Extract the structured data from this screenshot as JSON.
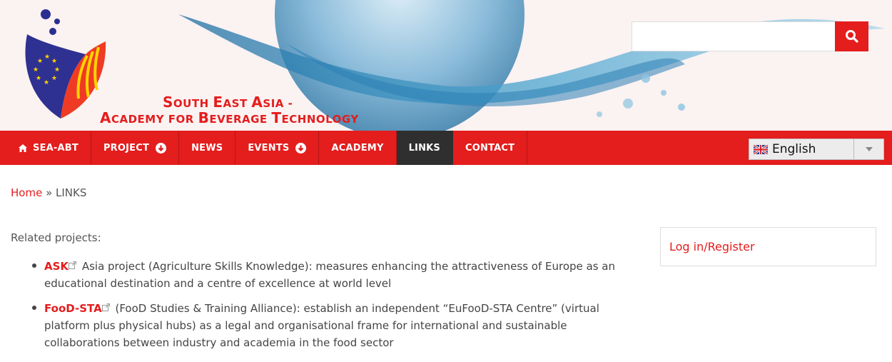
{
  "header": {
    "title_line1_parts": [
      "S",
      "OUTH ",
      "E",
      "AST ",
      "A",
      "SIA -"
    ],
    "title_line2_parts": [
      "A",
      "CADEMY FOR ",
      "B",
      "EVERAGE ",
      "T",
      "ECHNOLOGY"
    ]
  },
  "search": {
    "placeholder": "",
    "value": "",
    "icon": "search-icon"
  },
  "nav": {
    "items": [
      {
        "label": "SEA-ABT",
        "icon": "home-icon",
        "dropdown": false,
        "active": false
      },
      {
        "label": "PROJECT",
        "dropdown": true,
        "active": false
      },
      {
        "label": "NEWS",
        "dropdown": false,
        "active": false
      },
      {
        "label": "EVENTS",
        "dropdown": true,
        "active": false
      },
      {
        "label": "ACADEMY",
        "dropdown": false,
        "active": false
      },
      {
        "label": "LINKS",
        "dropdown": false,
        "active": true
      },
      {
        "label": "CONTACT",
        "dropdown": false,
        "active": false
      }
    ],
    "language": {
      "selected": "English",
      "flag_icon": "uk-flag-icon"
    }
  },
  "breadcrumb": {
    "home": "Home",
    "separator": " » ",
    "current": "LINKS"
  },
  "content": {
    "intro": "Related projects:",
    "projects": [
      {
        "link": "ASK",
        "text": "Asia project (Agriculture Skills Knowledge): measures enhancing the attractiveness of Europe as an educational destination and a centre of excellence at world level"
      },
      {
        "link": "FooD-STA",
        "text": "(FooD Studies & Training Alliance): establish an independent “EuFooD-STA Centre” (virtual platform plus physical hubs) as a legal and organisational frame for international and sustainable collaborations between industry and academia in the food sector"
      }
    ]
  },
  "sidebar": {
    "login_label": "Log in/Register"
  },
  "colors": {
    "brand_red": "#e41d1d",
    "active_nav": "#2f2f2f",
    "banner_bg": "#fbf2f2"
  }
}
